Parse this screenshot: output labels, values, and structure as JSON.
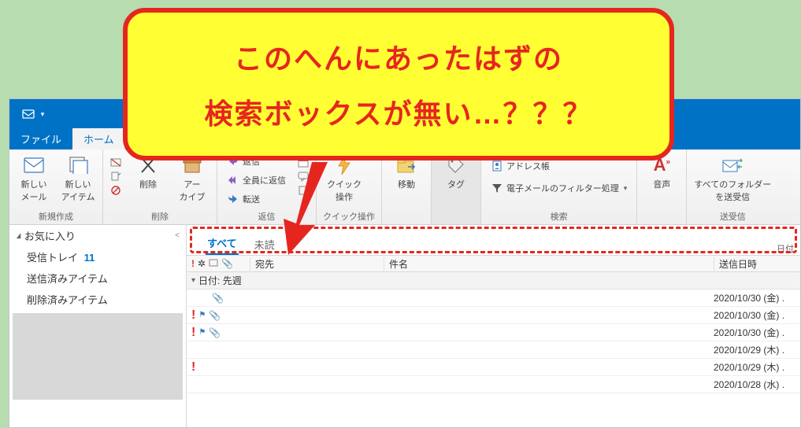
{
  "annotation": {
    "line1": "このへんにあったはずの",
    "line2": "検索ボックスが無い…？？？"
  },
  "tabs": {
    "file": "ファイル",
    "home": "ホーム"
  },
  "ribbon": {
    "new": {
      "new_mail": "新しい\nメール",
      "new_items": "新しい\nアイテム",
      "label": "新規作成"
    },
    "delete": {
      "delete": "削除",
      "archive": "アー\nカイブ",
      "label": "削除"
    },
    "respond": {
      "reply": "返信",
      "reply_all": "全員に返信",
      "forward": "転送",
      "label": "返信"
    },
    "quick": {
      "quick_ops": "クイック\n操作",
      "label": "クイック操作"
    },
    "move": {
      "move": "移動",
      "label": ""
    },
    "tags": {
      "tags": "タグ",
      "label": ""
    },
    "find": {
      "address_book": "アドレス帳",
      "filter": "電子メールのフィルター処理",
      "label": "検索"
    },
    "speech": {
      "speech": "音声",
      "label": ""
    },
    "sendrecv": {
      "all_folders": "すべてのフォルダー\nを送受信",
      "label": "送受信"
    }
  },
  "nav": {
    "favorites_hdr": "お気に入り",
    "inbox": "受信トレイ",
    "inbox_count": "11",
    "sent": "送信済みアイテム",
    "deleted": "削除済みアイテム"
  },
  "filter": {
    "all": "すべて",
    "unread": "未読"
  },
  "columns": {
    "from": "宛先",
    "subject": "件名",
    "date": "送信日時"
  },
  "group_hdr": "日付: 先週",
  "rows": [
    {
      "important": false,
      "flag": false,
      "attach": true,
      "date": "2020/10/30 (金) ."
    },
    {
      "important": true,
      "flag": true,
      "attach": true,
      "date": "2020/10/30 (金) ."
    },
    {
      "important": true,
      "flag": true,
      "attach": true,
      "date": "2020/10/30 (金) ."
    },
    {
      "important": false,
      "flag": false,
      "attach": false,
      "date": "2020/10/29 (木) ."
    },
    {
      "important": true,
      "flag": false,
      "attach": false,
      "date": "2020/10/29 (木) ."
    },
    {
      "important": false,
      "flag": false,
      "attach": false,
      "date": "2020/10/28 (水) ."
    }
  ]
}
